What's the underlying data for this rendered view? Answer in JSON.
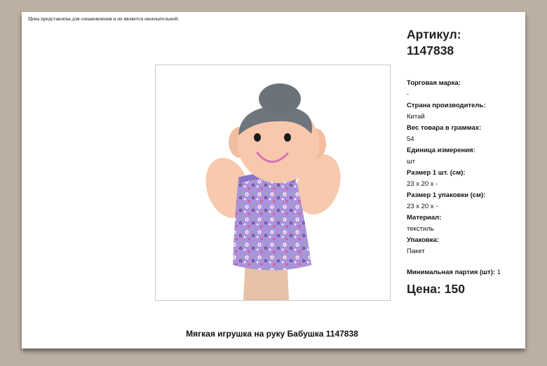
{
  "disclaimer": "Цена представлена для ознакомления и не является окончательной.",
  "article": {
    "label": "Артикул:",
    "value": "1147838"
  },
  "specs": [
    {
      "label": "Торговая марка:",
      "value": "-"
    },
    {
      "label": "Страна производитель:",
      "value": "Китай"
    },
    {
      "label": "Вес товара в граммах:",
      "value": "54"
    },
    {
      "label": "Единица измерения:",
      "value": "шт"
    },
    {
      "label": "Размер 1 шт. (см):",
      "value": "23 x 20 x -"
    },
    {
      "label": "Размер 1 упаковки (см):",
      "value": "23 x 20 x -"
    },
    {
      "label": "Материал:",
      "value": "текстиль"
    },
    {
      "label": "Упаковка:",
      "value": "Пакет"
    }
  ],
  "min_batch": {
    "label": "Минимальная партия (шт):",
    "value": "1"
  },
  "price": {
    "label": "Цена:",
    "value": "150"
  },
  "product_name": "Мягкая игрушка на руку Бабушка 1147838",
  "colors": {
    "background": "#bcb0a3",
    "hair": "#6e757d",
    "skin": "#f6c3a6",
    "dress": "#9c86d6"
  }
}
